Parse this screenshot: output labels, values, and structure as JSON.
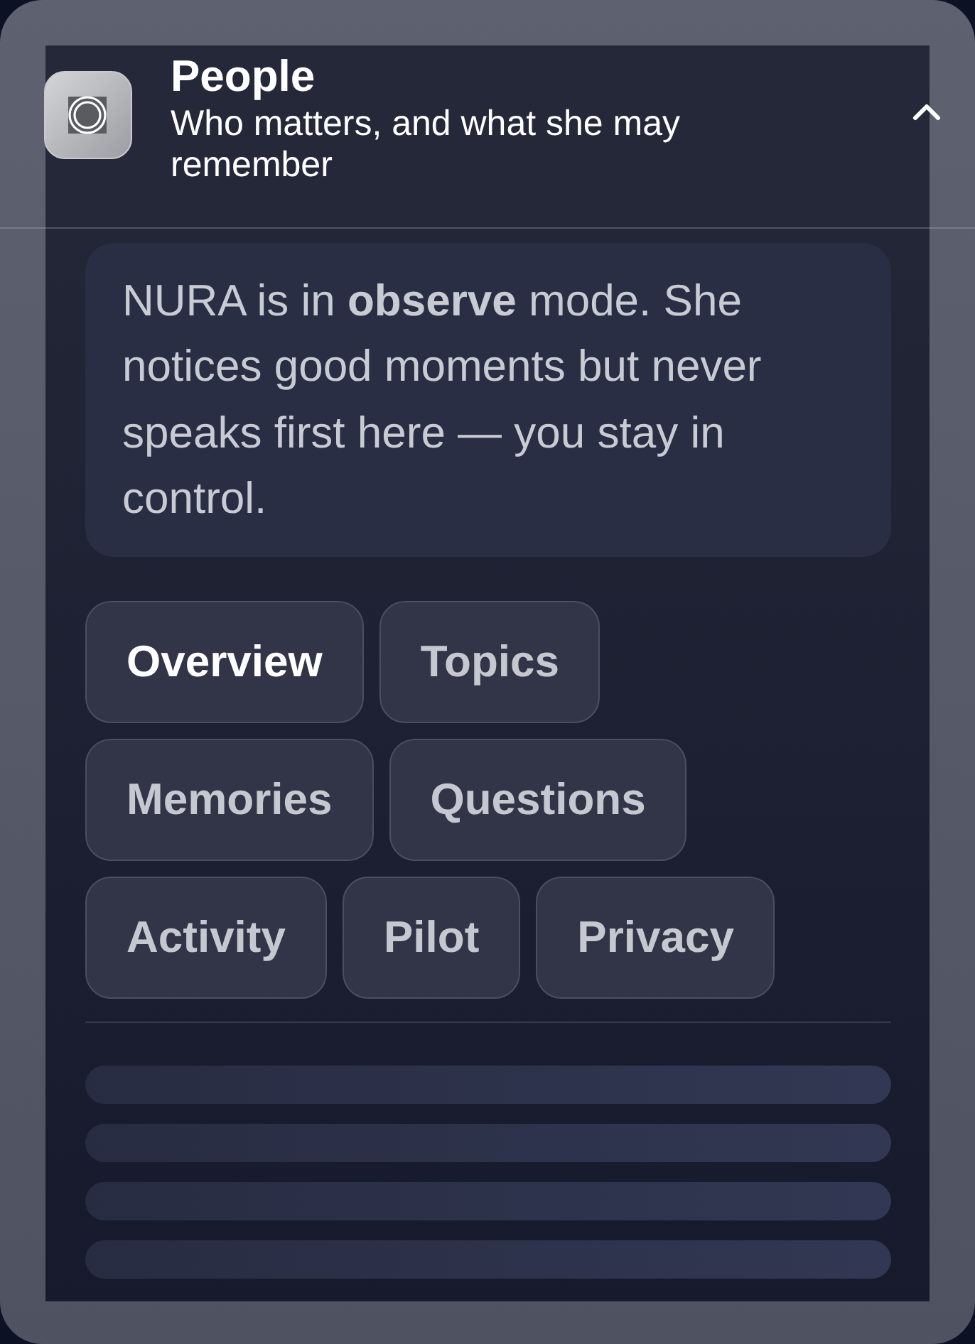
{
  "header": {
    "title": "People",
    "subtitle": "Who matters, and what she may remember",
    "expanded": true
  },
  "notice": {
    "text": "NURA is in **observe** mode. She notices good moments but never speaks first here — you stay in control."
  },
  "tabs": [
    {
      "label": "Overview",
      "selected": true
    },
    {
      "label": "Topics",
      "selected": false
    },
    {
      "label": "Memories",
      "selected": false
    },
    {
      "label": "Questions",
      "selected": false
    },
    {
      "label": "Activity",
      "selected": false
    },
    {
      "label": "Pilot",
      "selected": false
    },
    {
      "label": "Privacy",
      "selected": false
    }
  ],
  "placeholder_rows": [
    {
      "kind": "skeleton"
    },
    {
      "kind": "skeleton"
    },
    {
      "kind": "skeleton"
    },
    {
      "kind": "skeleton"
    }
  ]
}
